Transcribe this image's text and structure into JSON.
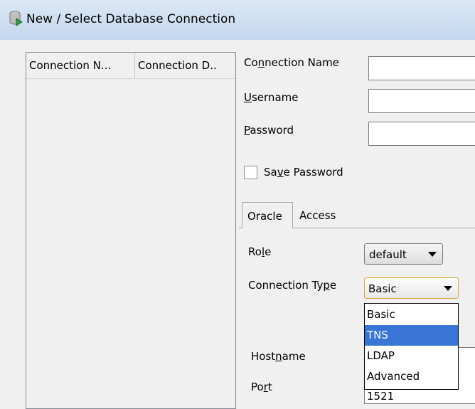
{
  "window": {
    "title": "New / Select Database Connection"
  },
  "connections_list": {
    "columns": [
      "Connection N...",
      "Connection D.."
    ]
  },
  "form": {
    "connection_name": {
      "label_pre": "Co",
      "label_u": "n",
      "label_post": "nection Name",
      "value": ""
    },
    "username": {
      "label_pre": "",
      "label_u": "U",
      "label_post": "sername",
      "value": ""
    },
    "password": {
      "label_pre": "",
      "label_u": "P",
      "label_post": "assword",
      "value": ""
    },
    "save_password": {
      "label_pre": "Sa",
      "label_u": "v",
      "label_post": "e Password",
      "checked": false
    }
  },
  "tabs": [
    {
      "label": "Oracle",
      "active": true
    },
    {
      "label": "Access",
      "active": false
    }
  ],
  "oracle": {
    "role": {
      "label_pre": "Ro",
      "label_u": "l",
      "label_post": "e",
      "value": "default"
    },
    "connection_type": {
      "label_pre": "Connection Ty",
      "label_u": "p",
      "label_post": "e",
      "value": "Basic",
      "options": [
        "Basic",
        "TNS",
        "LDAP",
        "Advanced"
      ],
      "highlighted": "TNS"
    },
    "hostname": {
      "label_pre": "Host",
      "label_u": "n",
      "label_post": "ame"
    },
    "port": {
      "label_pre": "Po",
      "label_u": "r",
      "label_post": "t",
      "value": "1521"
    }
  }
}
